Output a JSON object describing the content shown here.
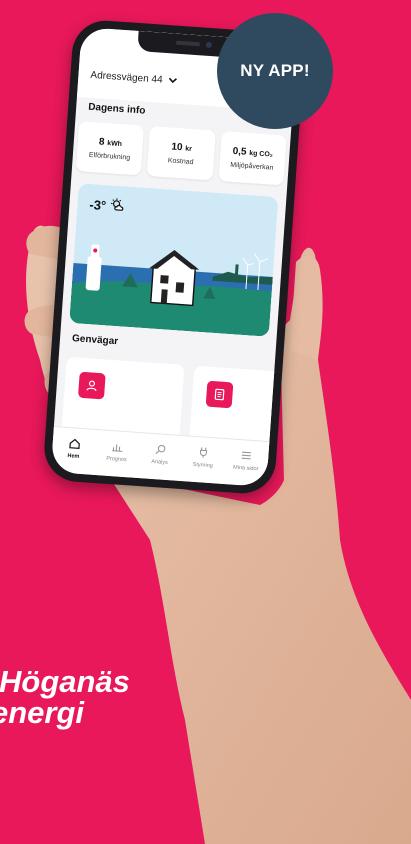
{
  "badge": {
    "text": "NY APP!",
    "color": "#2f4a5f"
  },
  "brand": {
    "line1": "Höganäs",
    "line2": "energi"
  },
  "app": {
    "address": "Adressvägen 44",
    "todays_info_title": "Dagens info",
    "info_cards": [
      {
        "value": "8",
        "unit": "kWh",
        "label": "Elförbrukning"
      },
      {
        "value": "10",
        "unit": "kr",
        "label": "Kostnad"
      },
      {
        "value": "0,5",
        "unit": "kg CO₂",
        "label": "Miljöpåverkan"
      }
    ],
    "weather": {
      "temperature": "-3°",
      "icon": "partly-cloudy-icon"
    },
    "shortcuts_title": "Genvägar",
    "shortcuts": [
      {
        "icon": "person-icon"
      },
      {
        "icon": "document-icon"
      }
    ],
    "tabs": [
      {
        "label": "Hem",
        "icon": "home-icon",
        "active": true
      },
      {
        "label": "Prognos",
        "icon": "bar-chart-icon",
        "active": false
      },
      {
        "label": "Analys",
        "icon": "search-icon",
        "active": false
      },
      {
        "label": "Styrning",
        "icon": "plug-icon",
        "active": false
      },
      {
        "label": "Mina sidor",
        "icon": "menu-icon",
        "active": false
      }
    ]
  },
  "colors": {
    "background": "#e8185a",
    "accent": "#e8185a",
    "dark": "#2f4a5f"
  }
}
